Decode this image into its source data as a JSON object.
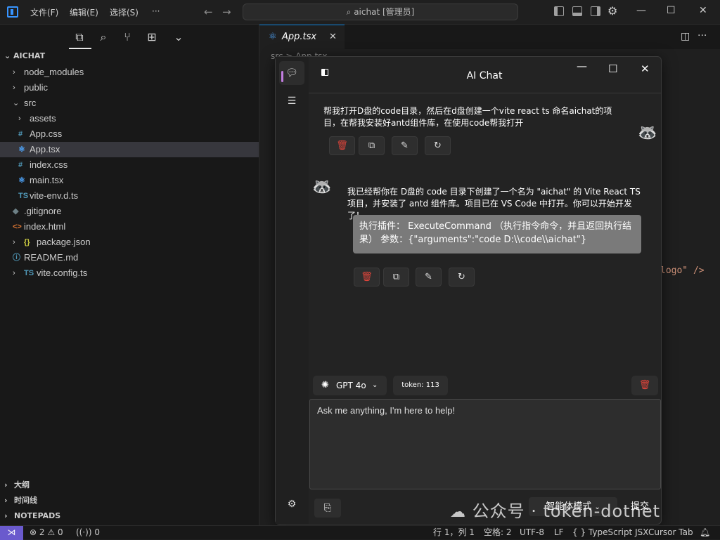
{
  "titlebar": {
    "menus": [
      "文件(F)",
      "编辑(E)",
      "选择(S)",
      "···"
    ],
    "search_text": "aichat [管理员]"
  },
  "sidebar": {
    "explorer_title": "AICHAT",
    "tree": [
      {
        "label": "node_modules",
        "kind": "folder",
        "icon": ""
      },
      {
        "label": "public",
        "kind": "folder",
        "icon": ""
      },
      {
        "label": "src",
        "kind": "folder-open",
        "icon": ""
      },
      {
        "label": "assets",
        "kind": "folder",
        "icon": ""
      },
      {
        "label": "App.css",
        "kind": "file",
        "icon": "#"
      },
      {
        "label": "App.tsx",
        "kind": "file",
        "icon": "⚛",
        "selected": true
      },
      {
        "label": "index.css",
        "kind": "file",
        "icon": "#"
      },
      {
        "label": "main.tsx",
        "kind": "file",
        "icon": "⚛"
      },
      {
        "label": "vite-env.d.ts",
        "kind": "file",
        "icon": "TS"
      },
      {
        "label": ".gitignore",
        "kind": "file",
        "icon": "◆"
      },
      {
        "label": "index.html",
        "kind": "file",
        "icon": "<>"
      },
      {
        "label": "package.json",
        "kind": "folder",
        "icon": "{}"
      },
      {
        "label": "README.md",
        "kind": "file",
        "icon": "ⓘ"
      },
      {
        "label": "vite.config.ts",
        "kind": "folder",
        "icon": "TS"
      }
    ],
    "sections": [
      "大纲",
      "时间线",
      "NOTEPADS"
    ]
  },
  "editor": {
    "tab_label": "App.tsx",
    "breadcrumb": "src > App.tsx",
    "code_fragment": "logo\" />"
  },
  "chat": {
    "title": "AI Chat",
    "user_message": "帮我打开D盘的code目录，然后在d盘创建一个vite react ts 命名aichat的项目，在帮我安装好antd组件库，在使用code帮我打开",
    "assistant_message": "我已经帮你在 D盘的 code 目录下创建了一个名为 \"aichat\" 的 Vite React TS 项目，并安装了 antd 组件库。项目已在 VS Code 中打开。你可以开始开发了！",
    "plugin_text": "执行插件： ExecuteCommand （执行指令命令，并且返回执行结果）  参数：{\"arguments\":\"code D:\\\\code\\\\aichat\"}",
    "model": "GPT 4o",
    "token_label": "token:",
    "token_count": "113",
    "input_placeholder": "Ask me anything, I'm here to help!",
    "mode_button": "智能体模式",
    "submit_button": "提交"
  },
  "statusbar": {
    "errors": "2",
    "warnings": "0",
    "ports": "0",
    "position": "行 1，列 1",
    "spaces": "空格: 2",
    "encoding": "UTF-8",
    "eol": "LF",
    "language": "{ } TypeScript JSX",
    "cursor_tab": "Cursor Tab"
  },
  "watermark": "公众号 · token-dotnet",
  "colors": {
    "accent": "#0078d4",
    "danger": "#e0453b",
    "remote": "#6a5acd",
    "rail_indicator": "#c27de0"
  }
}
